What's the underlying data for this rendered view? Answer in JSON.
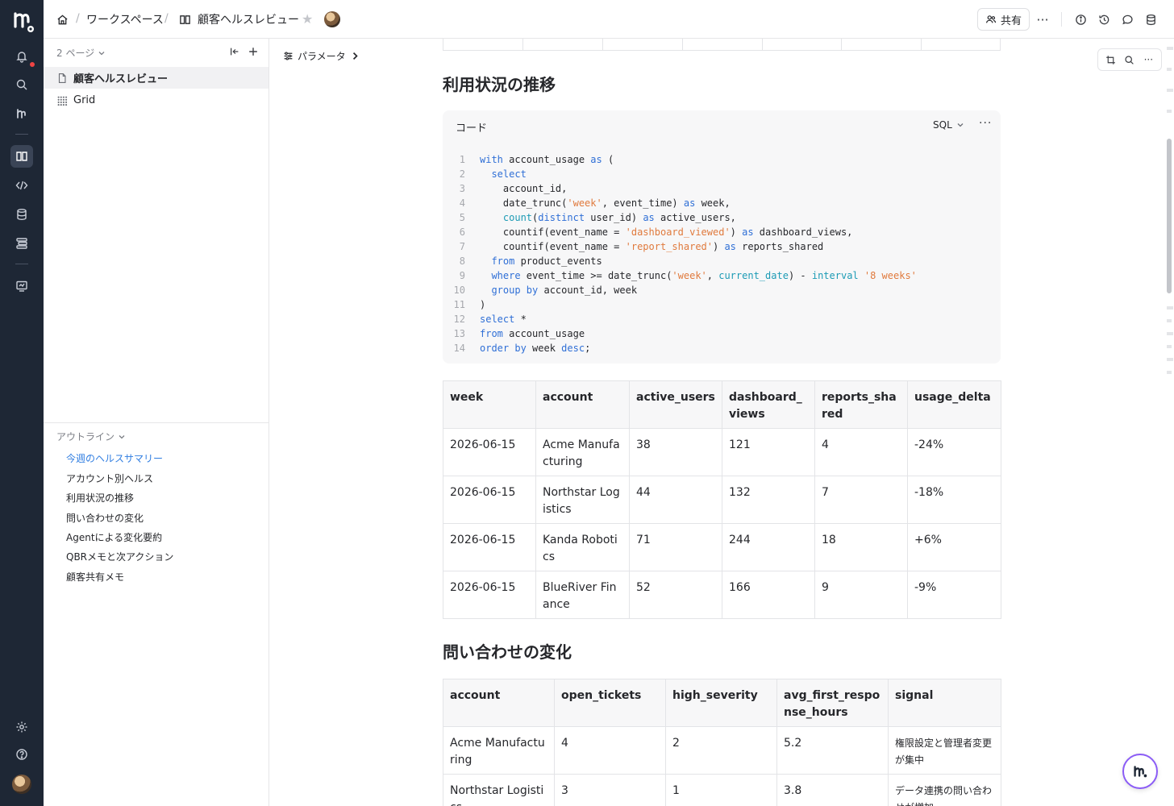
{
  "breadcrumb": {
    "home_icon": "home-icon",
    "workspace": "ワークスペース",
    "notebook": "顧客ヘルスレビュー",
    "star_icon": "star-icon"
  },
  "header": {
    "share_label": "共有",
    "more": "···"
  },
  "sidebar": {
    "pages_label": "2 ページ",
    "pages": [
      {
        "label": "顧客ヘルスレビュー",
        "icon": "document-icon"
      },
      {
        "label": "Grid",
        "icon": "grid-icon"
      }
    ],
    "outline_label": "アウトライン",
    "outline": [
      "今週のヘルスサマリー",
      "アカウント別ヘルス",
      "利用状況の推移",
      "問い合わせの変化",
      "Agentによる変化要約",
      "QBRメモと次アクション",
      "顧客共有メモ"
    ]
  },
  "params_label": "パラメータ",
  "section_usage": {
    "title": "利用状況の推移",
    "code_title": "コード",
    "code_lang": "SQL",
    "code_more": "···"
  },
  "usage_table": {
    "columns": [
      "week",
      "account",
      "active_users",
      "dashboard_views",
      "reports_shared",
      "usage_delta"
    ],
    "rows": [
      [
        "2026-06-15",
        "Acme Manufacturing",
        "38",
        "121",
        "4",
        "-24%"
      ],
      [
        "2026-06-15",
        "Northstar Logistics",
        "44",
        "132",
        "7",
        "-18%"
      ],
      [
        "2026-06-15",
        "Kanda Robotics",
        "71",
        "244",
        "18",
        "+6%"
      ],
      [
        "2026-06-15",
        "BlueRiver Finance",
        "52",
        "166",
        "9",
        "-9%"
      ]
    ]
  },
  "section_support": {
    "title": "問い合わせの変化"
  },
  "support_table": {
    "columns": [
      "account",
      "open_tickets",
      "high_severity",
      "avg_first_response_hours",
      "signal"
    ],
    "rows": [
      [
        "Acme Manufacturing",
        "4",
        "2",
        "5.2",
        "権限設定と管理者変更が集中"
      ],
      [
        "Northstar Logistics",
        "3",
        "1",
        "3.8",
        "データ連携の問い合わせが増加"
      ]
    ]
  }
}
